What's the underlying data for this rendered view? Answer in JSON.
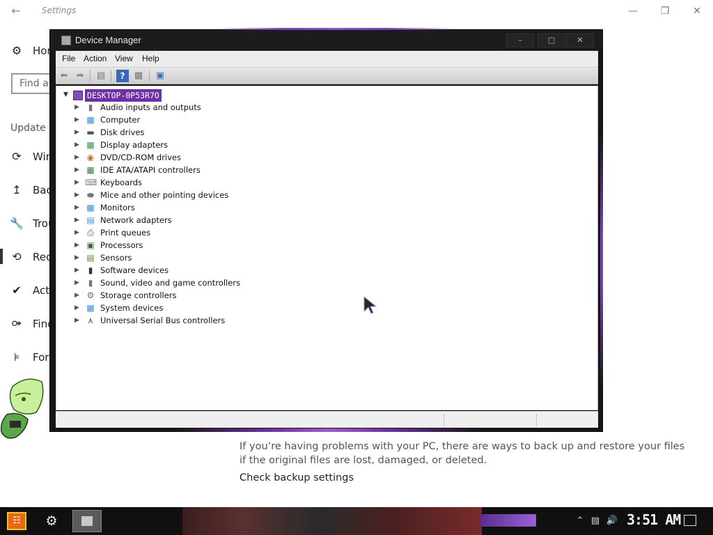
{
  "settings": {
    "window_title": "Settings",
    "nav": [
      {
        "icon": "gear-icon",
        "label": "Hor"
      },
      {
        "icon": "sync-icon",
        "label": "Win"
      },
      {
        "icon": "backup-arrow-icon",
        "label": "Bac"
      },
      {
        "icon": "wrench-icon",
        "label": "Trou"
      },
      {
        "icon": "history-icon",
        "label": "Rec"
      },
      {
        "icon": "check-circle-icon",
        "label": "Acti"
      },
      {
        "icon": "person-icon",
        "label": "Find"
      },
      {
        "icon": "developer-icon",
        "label": "For"
      }
    ],
    "find_placeholder": "Find a",
    "section_heading": "Update &",
    "backup_description": "If you’re having problems with your PC, there are ways to back up and restore your files if the original files are lost, damaged, or deleted.",
    "backup_link": "Check backup settings"
  },
  "device_manager": {
    "title": "Device Manager",
    "menu": [
      "File",
      "Action",
      "View",
      "Help"
    ],
    "toolbar_icons": [
      "back-arrow-icon",
      "forward-arrow-icon",
      "show-hide-console-tree-icon",
      "help-icon",
      "properties-icon",
      "scan-hardware-icon"
    ],
    "root_node": "DESKTOP-0P53R7O",
    "devices": [
      {
        "label": "Audio inputs and outputs",
        "icon": "speaker-icon"
      },
      {
        "label": "Computer",
        "icon": "monitor-icon"
      },
      {
        "label": "Disk drives",
        "icon": "disk-drive-icon"
      },
      {
        "label": "Display adapters",
        "icon": "display-adapter-icon"
      },
      {
        "label": "DVD/CD-ROM drives",
        "icon": "dvd-icon"
      },
      {
        "label": "IDE ATA/ATAPI controllers",
        "icon": "ide-controller-icon"
      },
      {
        "label": "Keyboards",
        "icon": "keyboard-icon"
      },
      {
        "label": "Mice and other pointing devices",
        "icon": "mouse-icon"
      },
      {
        "label": "Monitors",
        "icon": "monitor-icon"
      },
      {
        "label": "Network adapters",
        "icon": "network-adapter-icon"
      },
      {
        "label": "Print queues",
        "icon": "printer-icon"
      },
      {
        "label": "Processors",
        "icon": "processor-icon"
      },
      {
        "label": "Sensors",
        "icon": "sensor-icon"
      },
      {
        "label": "Software devices",
        "icon": "software-device-icon"
      },
      {
        "label": "Sound, video and game controllers",
        "icon": "speaker-icon"
      },
      {
        "label": "Storage controllers",
        "icon": "storage-controller-icon"
      },
      {
        "label": "System devices",
        "icon": "system-folder-icon"
      },
      {
        "label": "Universal Serial Bus controllers",
        "icon": "usb-icon"
      }
    ]
  },
  "taskbar": {
    "clock": "3:51 AM",
    "tray_icons": [
      "chevron-up-icon",
      "network-icon",
      "volume-icon",
      "notification-icon"
    ]
  },
  "colors": {
    "accent_purple": "#6f2fa6",
    "start_orange": "#e76a12"
  }
}
